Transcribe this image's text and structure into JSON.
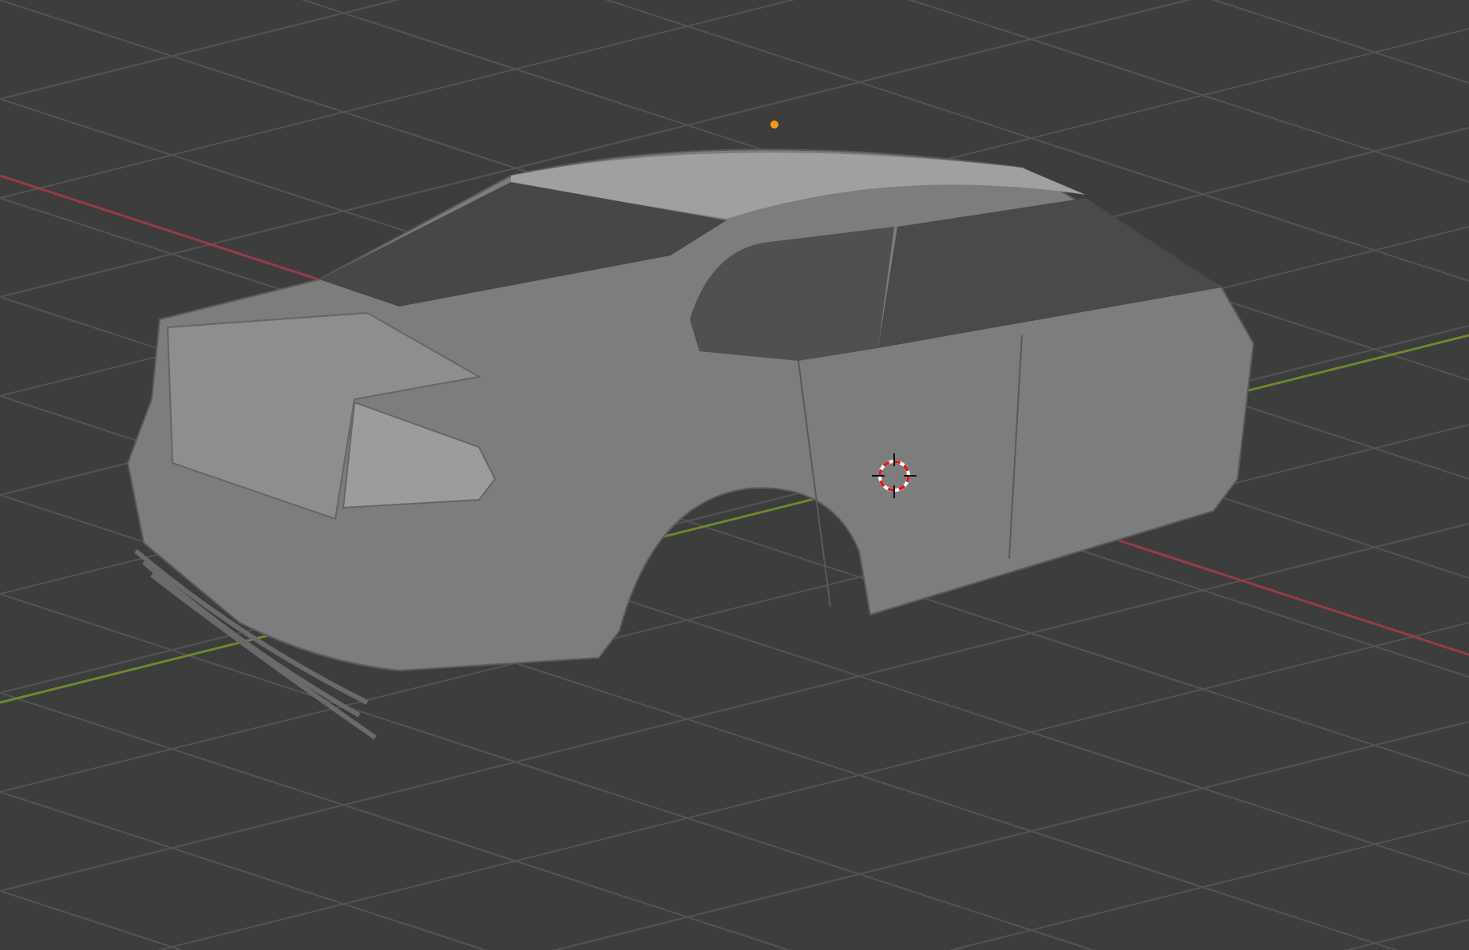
{
  "viewport": {
    "grid": true,
    "axes": true,
    "cursor_3d": true,
    "object_origin": true
  }
}
